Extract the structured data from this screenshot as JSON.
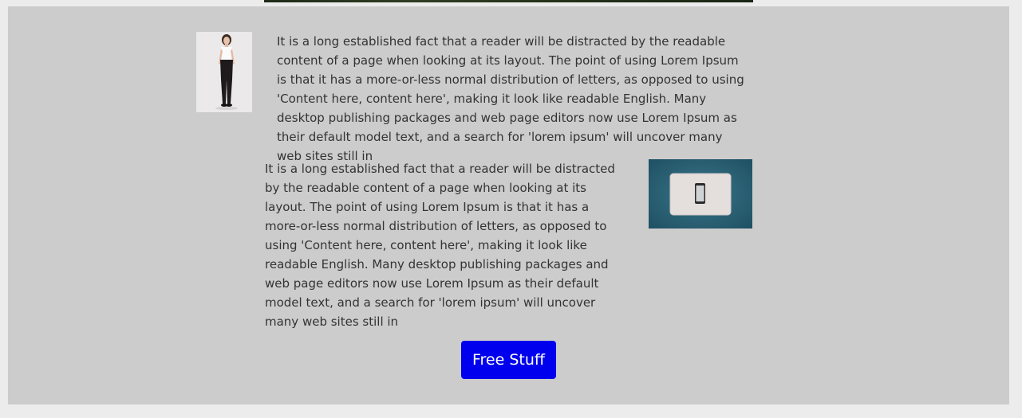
{
  "section1": {
    "paragraph": "It is a long established fact that a reader will be distracted by the readable content of a page when looking at its layout. The point of using Lorem Ipsum is that it has a more-or-less normal distribution of letters, as opposed to using 'Content here, content here', making it look like readable English. Many desktop publishing packages and web page editors now use Lorem Ipsum as their default model text, and a search for 'lorem ipsum' will uncover many web sites still in",
    "image_icon": "woman-standing-photo"
  },
  "section2": {
    "paragraph": "It is a long established fact that a reader will be distracted by the readable content of a page when looking at its layout. The point of using Lorem Ipsum is that it has a more-or-less normal distribution of letters, as opposed to using 'Content here, content here', making it look like readable English. Many desktop publishing packages and web page editors now use Lorem Ipsum as their default model text, and a search for 'lorem ipsum' will uncover many web sites still in",
    "image_icon": "laptop-phone-photo"
  },
  "cta": {
    "label": "Free Stuff",
    "color": "#0000ee"
  },
  "colors": {
    "panel_background": "#cccccc",
    "page_background": "#ececec",
    "text": "#333333"
  }
}
